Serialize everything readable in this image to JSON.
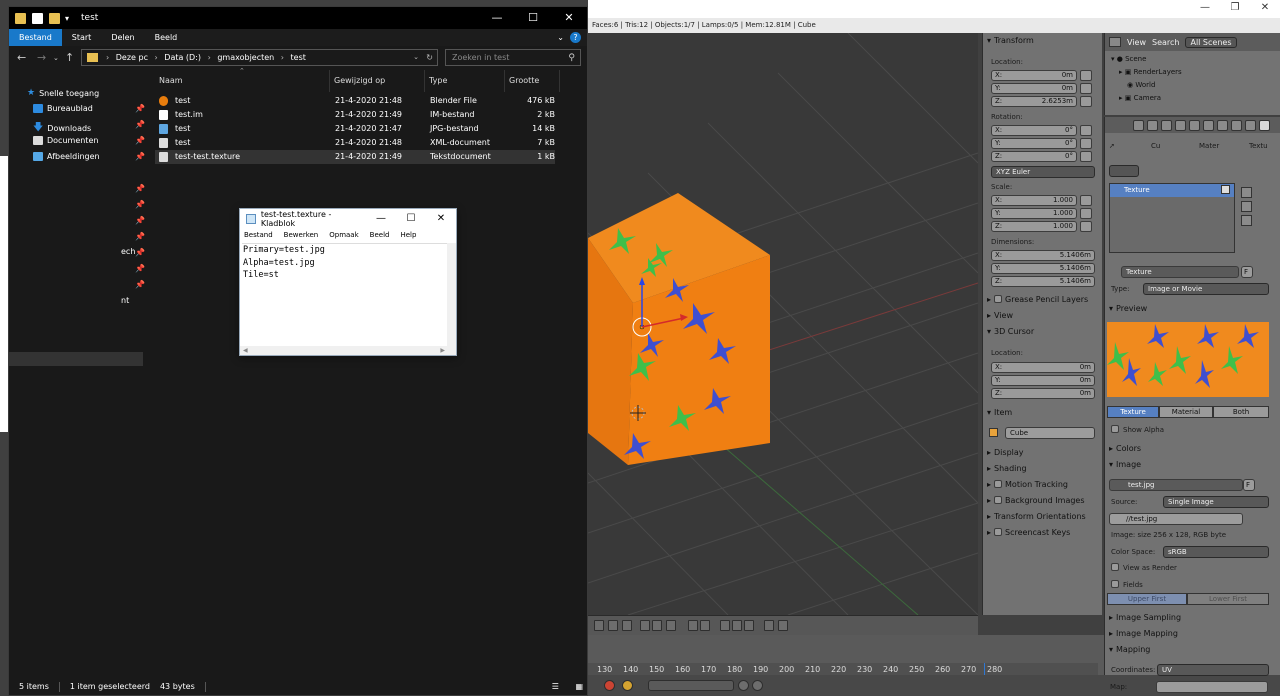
{
  "explorer": {
    "title": "test",
    "ribbon_tabs": [
      "Bestand",
      "Start",
      "Delen",
      "Beeld"
    ],
    "breadcrumb": [
      "Deze pc",
      "Data (D:)",
      "gmaxobjecten",
      "test"
    ],
    "search_placeholder": "Zoeken in test",
    "nav_items": [
      "Snelle toegang",
      "Bureaublad",
      "Downloads",
      "Documenten",
      "Afbeeldingen"
    ],
    "nav_fragments": [
      "ech",
      "nt"
    ],
    "columns": [
      "Naam",
      "Gewijzigd op",
      "Type",
      "Grootte"
    ],
    "files": [
      {
        "name": "test",
        "date": "21-4-2020 21:48",
        "type": "Blender File",
        "size": "476 kB",
        "icon": "blender-file-icon",
        "color": "#e87d0d"
      },
      {
        "name": "test.im",
        "date": "21-4-2020 21:49",
        "type": "IM-bestand",
        "size": "2 kB",
        "icon": "file-icon",
        "color": "#ffffff"
      },
      {
        "name": "test",
        "date": "21-4-2020 21:47",
        "type": "JPG-bestand",
        "size": "14 kB",
        "icon": "image-file-icon",
        "color": "#5ea6e0"
      },
      {
        "name": "test",
        "date": "21-4-2020 21:48",
        "type": "XML-document",
        "size": "7 kB",
        "icon": "xml-file-icon",
        "color": "#dcdcdc"
      },
      {
        "name": "test-test.texture",
        "date": "21-4-2020 21:49",
        "type": "Tekstdocument",
        "size": "1 kB",
        "icon": "text-file-icon",
        "color": "#dcdcdc"
      }
    ],
    "status_items": "5 items",
    "status_selected": "1 item geselecteerd",
    "status_size": "43 bytes"
  },
  "notepad": {
    "title": "test-test.texture - Kladblok",
    "menu": [
      "Bestand",
      "Bewerken",
      "Opmaak",
      "Beeld",
      "Help"
    ],
    "lines": [
      "Primary=test.jpg",
      "Alpha=test.jpg",
      "Tile=st"
    ]
  },
  "blender": {
    "info": "Faces:6 | Tris:12 | Objects:1/7 | Lamps:0/5 | Mem:12.81M | Cube",
    "transform": {
      "header": "Transform",
      "location_label": "Location:",
      "location": [
        "X:",
        "0m",
        "Y:",
        "0m",
        "Z:",
        "2.6253m"
      ],
      "rotation_label": "Rotation:",
      "rotation": [
        "X:",
        "0°",
        "Y:",
        "0°",
        "Z:",
        "0°"
      ],
      "rotation_mode": "XYZ Euler",
      "scale_label": "Scale:",
      "scale": [
        "X:",
        "1.000",
        "Y:",
        "1.000",
        "Z:",
        "1.000"
      ],
      "dimensions_label": "Dimensions:",
      "dimensions": [
        "X:",
        "5.1406m",
        "Y:",
        "5.1406m",
        "Z:",
        "5.1406m"
      ]
    },
    "npanel_sections": {
      "grease": "Grease Pencil Layers",
      "view": "View",
      "cursor": "3D Cursor",
      "cursor_location_label": "Location:",
      "cursor_location": [
        "X:",
        "0m",
        "Y:",
        "0m",
        "Z:",
        "0m"
      ],
      "item": "Item",
      "item_name": "Cube",
      "display": "Display",
      "shading": "Shading",
      "motion": "Motion Tracking",
      "background": "Background Images",
      "orientations": "Transform Orientations",
      "screencast": "Screencast Keys"
    },
    "outliner": {
      "view": "View",
      "search": "Search",
      "scenes": "All Scenes",
      "items": [
        "Scene",
        "RenderLayers",
        "World",
        "Camera"
      ]
    },
    "properties": {
      "context": [
        "Cu",
        "Mater",
        "Textu"
      ],
      "slot": "Texture",
      "datablock": "Texture",
      "datablock_f": "F",
      "type_label": "Type:",
      "type_value": "Image or Movie",
      "preview": "Preview",
      "preview_tabs": [
        "Texture",
        "Material",
        "Both"
      ],
      "show_alpha": "Show Alpha",
      "colors": "Colors",
      "image": "Image",
      "image_name": "test.jpg",
      "image_f": "F",
      "source_label": "Source:",
      "source_value": "Single Image",
      "filepath": "//test.jpg",
      "image_info": "Image: size 256 x 128, RGB byte",
      "colorspace_label": "Color Space:",
      "colorspace_value": "sRGB",
      "view_as_render": "View as Render",
      "fields": "Fields",
      "field_order": [
        "Upper First",
        "Lower First"
      ],
      "image_sampling": "Image Sampling",
      "image_mapping": "Image Mapping",
      "mapping": "Mapping",
      "coordinates_label": "Coordinates:",
      "coordinates_value": "UV",
      "map_label": "Map:"
    },
    "timeline_ticks": [
      "130",
      "140",
      "150",
      "160",
      "170",
      "180",
      "190",
      "200",
      "210",
      "220",
      "230",
      "240",
      "250",
      "260",
      "270",
      "280"
    ]
  }
}
